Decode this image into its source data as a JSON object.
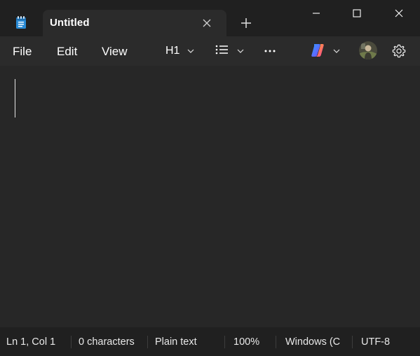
{
  "tab": {
    "title": "Untitled"
  },
  "menu": {
    "file": "File",
    "edit": "Edit",
    "view": "View"
  },
  "toolbar": {
    "heading": "H1",
    "more": "..."
  },
  "editor": {
    "content": ""
  },
  "status": {
    "position": "Ln 1, Col 1",
    "characters": "0 characters",
    "format": "Plain text",
    "zoom": "100%",
    "line_ending": "Windows (C",
    "encoding": "UTF-8"
  },
  "icons": {
    "app": "notepad-icon",
    "tab_close": "close-icon",
    "new_tab": "plus-icon",
    "minimize": "minimize-icon",
    "maximize": "maximize-icon",
    "close": "close-icon",
    "list": "bulleted-list-icon",
    "copilot": "copilot-icon",
    "avatar": "avatar",
    "settings": "gear-icon"
  },
  "colors": {
    "titlebar_bg": "#202020",
    "menubar_bg": "#2b2b2b",
    "editor_bg": "#272727",
    "text": "#ffffff"
  }
}
